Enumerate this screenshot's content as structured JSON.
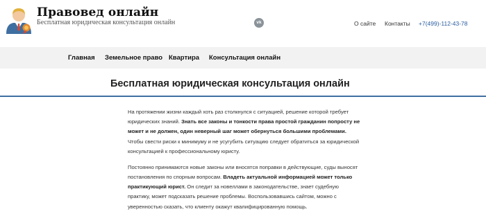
{
  "header": {
    "site_title": "Правовед онлайн",
    "site_description": "Бесплатная юридическая консультация онлайн",
    "social": {
      "icon": "vk-icon",
      "label": "vk"
    },
    "links": {
      "about": "О сайте",
      "contacts": "Контакты",
      "phone": "+7(499)-112-43-78"
    }
  },
  "nav": {
    "items": [
      {
        "label": "Главная"
      },
      {
        "label": "Земельное право"
      },
      {
        "label": "Квартира"
      },
      {
        "label": "Консультация онлайн"
      }
    ]
  },
  "main": {
    "title": "Бесплатная юридическая консультация онлайн",
    "paragraphs": [
      {
        "lead": "На протяжении жизни каждый хоть раз столкнулся с ситуацией, решение которой требует юридических знаний. ",
        "bold": "Знать все законы и тонкости права простой гражданин попросту не может и не должен, один неверный шаг может обернуться большими проблемами.",
        "tail": " Чтобы свести риски к минимуму и не усугубить ситуацию следует обратиться за юридической консультацией к профессиональному юристу."
      },
      {
        "lead": "Постоянно принимаются новые законы или вносятся поправки в действующие, суды выносят постановления по спорным вопросам. ",
        "bold": "Владеть актуальной информацией может только практикующий юрист.",
        "tail": " Он следит за новеллами в законодательстве, знает судебную практику, может подсказать решение проблемы. Воспользовавшись сайтом, можно с уверенностью сказать, что клиенту окажут квалифицированную помощь."
      }
    ]
  },
  "colors": {
    "accent": "#3f6fa0",
    "phone": "#2a5d9f",
    "nav_background": "#f2f2f2"
  }
}
